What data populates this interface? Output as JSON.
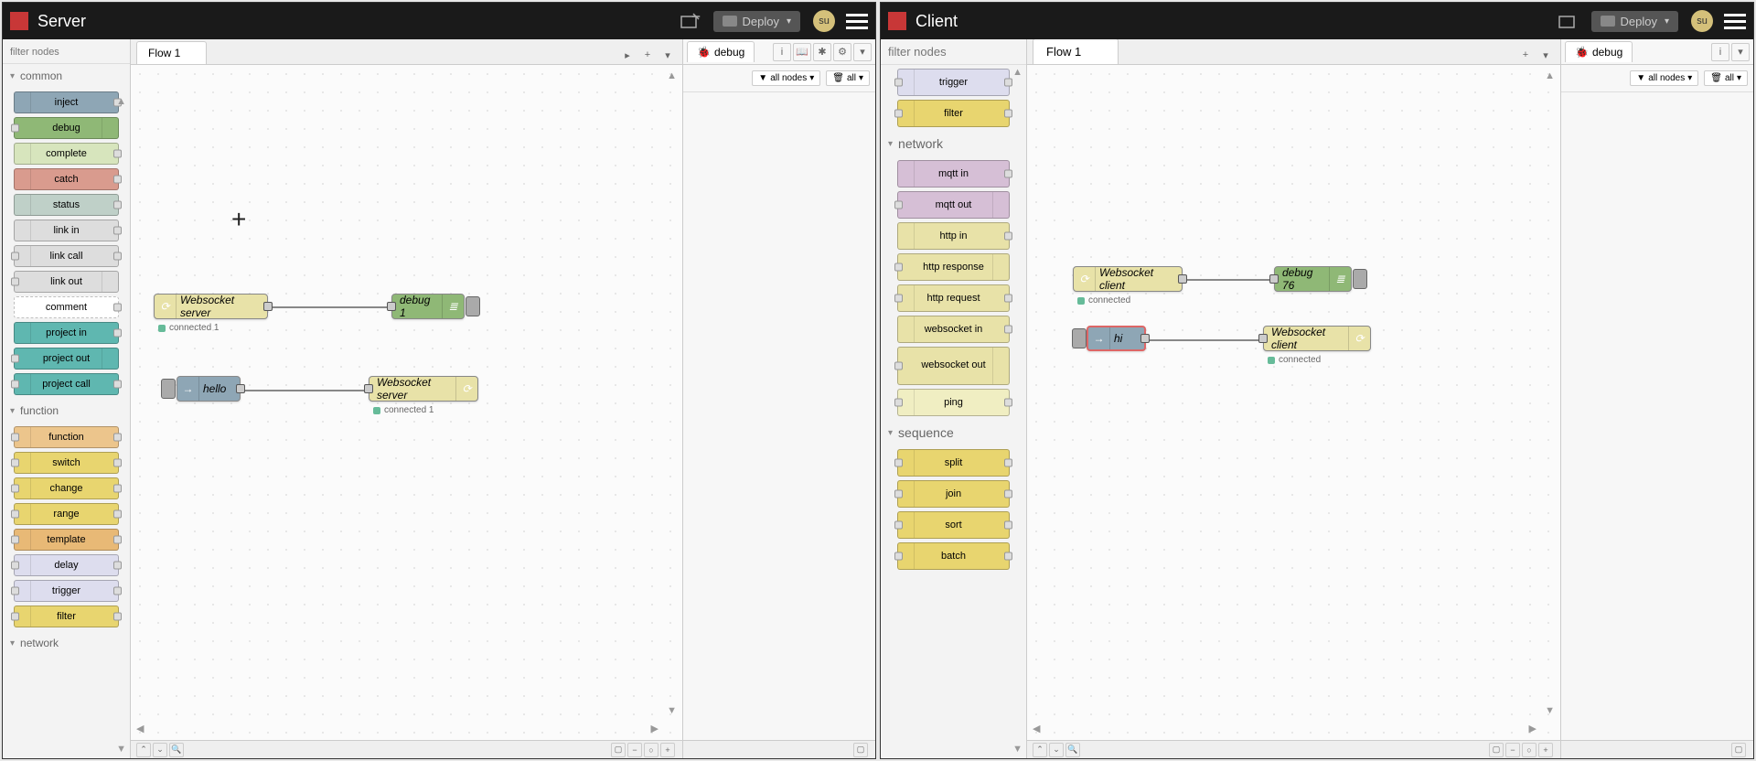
{
  "server": {
    "title": "Server",
    "avatar": "su",
    "deploy_label": "Deploy",
    "filter_placeholder": "filter nodes",
    "tab_label": "Flow 1",
    "debug_tab": "debug",
    "filter_all_nodes": "all nodes",
    "clear_all": "all",
    "palette": {
      "cat_common": "common",
      "cat_function": "function",
      "cat_network": "network",
      "inject": "inject",
      "debug": "debug",
      "complete": "complete",
      "catch": "catch",
      "status": "status",
      "link_in": "link in",
      "link_call": "link call",
      "link_out": "link out",
      "comment": "comment",
      "project_in": "project in",
      "project_out": "project out",
      "project_call": "project call",
      "function": "function",
      "switch": "switch",
      "change": "change",
      "range": "range",
      "template": "template",
      "delay": "delay",
      "trigger": "trigger",
      "filter": "filter"
    },
    "nodes": {
      "ws_in_label": "Websocket server",
      "ws_in_status": "connected 1",
      "debug1_label": "debug 1",
      "hello_label": "hello",
      "ws_out_label": "Websocket server",
      "ws_out_status": "connected 1"
    }
  },
  "client": {
    "title": "Client",
    "avatar": "su",
    "deploy_label": "Deploy",
    "filter_placeholder": "filter nodes",
    "tab_label": "Flow 1",
    "debug_tab": "debug",
    "filter_all_nodes": "all nodes",
    "clear_all": "all",
    "palette": {
      "cat_network": "network",
      "cat_sequence": "sequence",
      "trigger": "trigger",
      "filter": "filter",
      "mqtt_in": "mqtt in",
      "mqtt_out": "mqtt out",
      "http_in": "http in",
      "http_response": "http response",
      "http_request": "http request",
      "websocket_in": "websocket in",
      "websocket_out": "websocket out",
      "ping": "ping",
      "split": "split",
      "join": "join",
      "sort": "sort",
      "batch": "batch"
    },
    "nodes": {
      "ws_in_label": "Websocket client",
      "ws_in_status": "connected",
      "debug_label": "debug 76",
      "hi_label": "hi",
      "ws_out_label": "Websocket client",
      "ws_out_status": "connected"
    }
  }
}
